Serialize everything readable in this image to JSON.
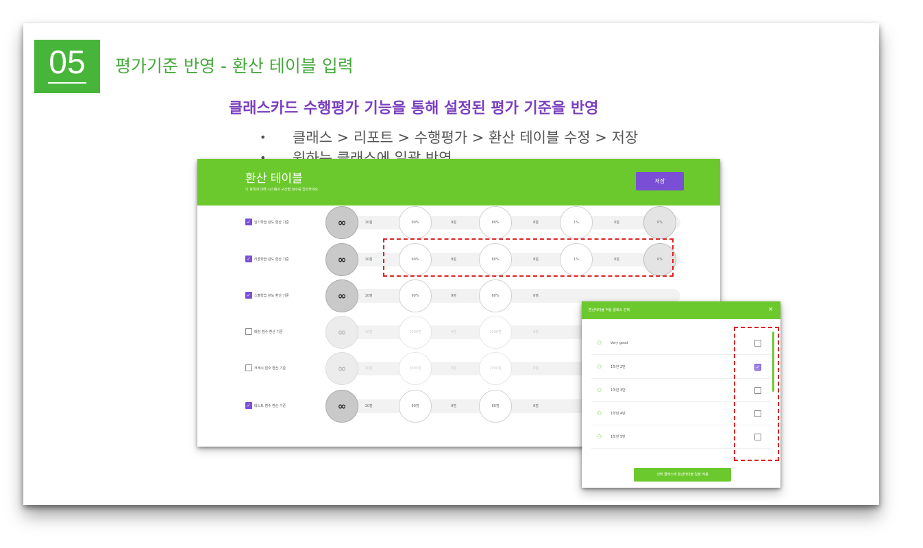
{
  "slide": {
    "number": "05",
    "title": "평가기준 반영 - 환산 테이블 입력",
    "subheading": "클래스카드 수행평가 기능을 통해 설정된 평가 기준을 반영",
    "bullets": [
      "클래스 > 리포트 > 수행평가 > 환산 테이블 수정 > 저장",
      "원하는 클래스에 일괄 반영"
    ],
    "bullet_glyph": "•"
  },
  "panel": {
    "title": "환산 테이블",
    "subtitle": "이 항목에 대해 시스템이 구간별 점수를 입력하세요.",
    "save_label": "저장",
    "infinity": "∞",
    "rows": [
      {
        "label": "암기학습 완도 환산 기준",
        "checked": true,
        "enabled": true,
        "values": [
          "10점",
          "90%",
          "9점",
          "80%",
          "8점",
          "1%",
          "0점",
          "0%"
        ]
      },
      {
        "label": "리콜학습 완도 환산 기준",
        "checked": true,
        "enabled": true,
        "values": [
          "10점",
          "90%",
          "9점",
          "80%",
          "8점",
          "1%",
          "0점",
          "0%"
        ]
      },
      {
        "label": "스펠학습 완도 환산 기준",
        "checked": true,
        "enabled": true,
        "values": [
          "10점",
          "90%",
          "9점",
          "80%",
          "8점",
          "",
          "",
          ""
        ]
      },
      {
        "label": "매칭 점수 환산 기준",
        "checked": false,
        "enabled": false,
        "values": [
          "10점",
          "3000점",
          "9점",
          "2000점",
          "8점",
          "",
          "",
          ""
        ]
      },
      {
        "label": "크래시 점수 환산 기준",
        "checked": false,
        "enabled": false,
        "values": [
          "10점",
          "3000점",
          "9점",
          "2000점",
          "8점",
          "",
          "",
          ""
        ]
      },
      {
        "label": "테스트 점수 환산 기준",
        "checked": true,
        "enabled": true,
        "values": [
          "10점",
          "90점",
          "9점",
          "80점",
          "8점",
          "",
          "",
          ""
        ]
      }
    ]
  },
  "modal": {
    "title": "환산테이블 적용 클래스 선택",
    "close": "×",
    "group_icon": "👥",
    "classes": [
      {
        "name": "Very good",
        "checked": false
      },
      {
        "name": "1학년 2반",
        "checked": true
      },
      {
        "name": "1학년 3반",
        "checked": false
      },
      {
        "name": "1학년 4반",
        "checked": false
      },
      {
        "name": "1학년 5반",
        "checked": false
      }
    ],
    "apply_label": "선택 클래스에 환산테이블 일괄 적용"
  },
  "colors": {
    "green": "#6cc92d",
    "slide_green": "#47b53a",
    "purple": "#7a4fd6",
    "highlight": "#e02020"
  }
}
